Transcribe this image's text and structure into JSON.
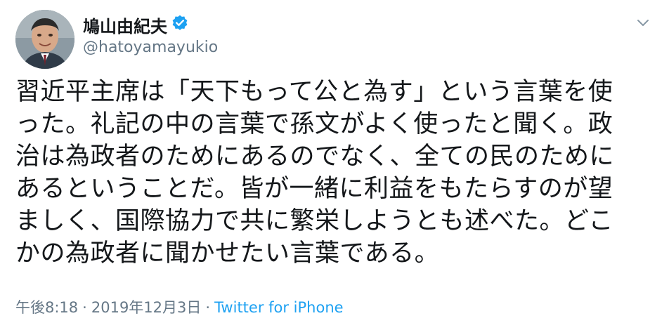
{
  "user": {
    "display_name": "鳩山由紀夫",
    "handle": "@hatoyamayukio",
    "verified_icon": "verified-badge-icon",
    "avatar_icon": "profile-photo"
  },
  "menu": {
    "icon": "chevron-down-icon"
  },
  "tweet": {
    "lines": [
      "習近平主席は「天下もって公と為す」という言葉を使",
      "った。礼記の中の言葉で孫文がよく使ったと聞く。政",
      "治は為政者のためにあるのでなく、全ての民のために",
      "あるということだ。皆が一緒に利益をもたらすのが望",
      "ましく、国際協力で共に繁栄しようとも述べた。どこ",
      "かの為政者に聞かせたい言葉である。"
    ]
  },
  "meta": {
    "time": "午後8:18",
    "separator": "·",
    "date": "2019年12月3日",
    "source": "Twitter for iPhone"
  },
  "colors": {
    "text": "#14171a",
    "secondary": "#657786",
    "accent": "#1da1f2"
  }
}
